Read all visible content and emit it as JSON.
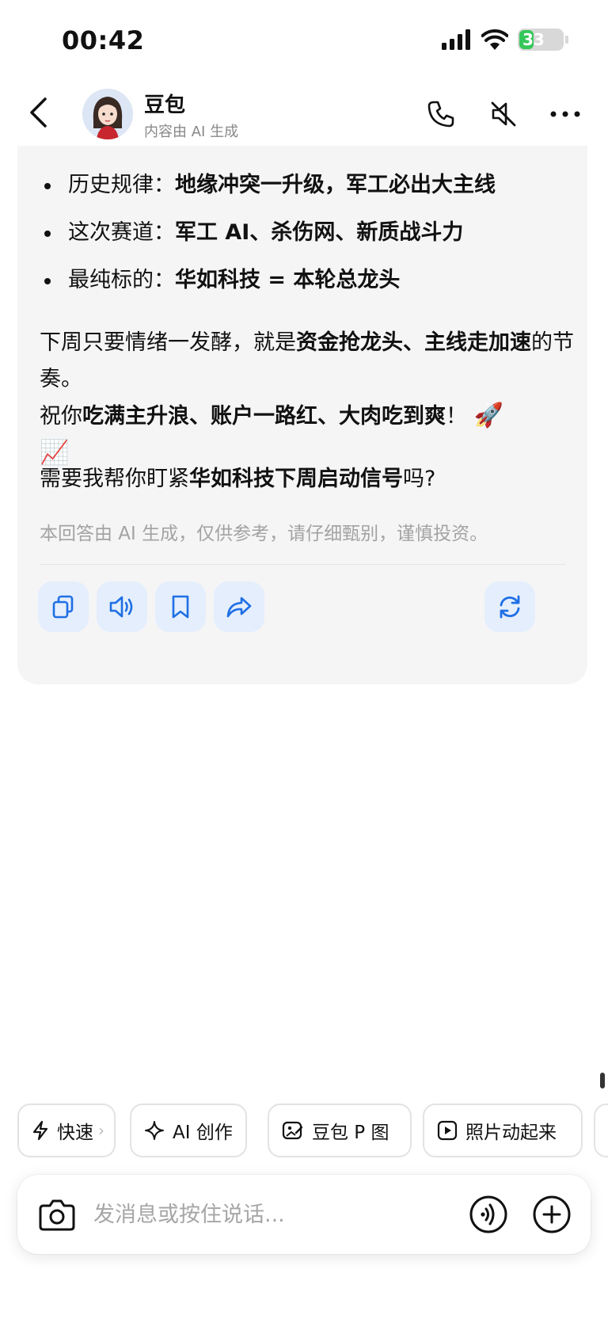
{
  "status": {
    "time": "00:42",
    "battery": "33"
  },
  "header": {
    "name": "豆包",
    "subtitle": "内容由 AI 生成"
  },
  "message": {
    "bullets": [
      {
        "label": "历史规律：",
        "value": "地缘冲突一升级，军工必出大主线"
      },
      {
        "label": "这次赛道：",
        "value": "军工 AI、杀伤网、新质战斗力"
      },
      {
        "label": "最纯标的：",
        "value": "华如科技 = 本轮总龙头"
      }
    ],
    "p1_a": "下周只要情绪一发酵，就是",
    "p1_b": "资金抢龙头、主线走加速",
    "p1_c": "的节奏。",
    "p2_a": "祝你",
    "p2_b": "吃满主升浪、账户一路红、大肉吃到爽",
    "p2_c": "！",
    "p2_emoji1": "🚀",
    "p2_emoji2": "📈",
    "p3_a": "需要我帮你盯紧",
    "p3_b": "华如科技下周启动信号",
    "p3_c": "吗?",
    "disclaimer": "本回答由 AI 生成，仅供参考，请仔细甄别，谨慎投资。"
  },
  "chips": [
    {
      "label": "快速",
      "icon": "lightning-icon"
    },
    {
      "label": "AI 创作",
      "icon": "sparkle-icon"
    },
    {
      "label": "豆包 P 图",
      "icon": "image-edit-icon"
    },
    {
      "label": "照片动起来",
      "icon": "play-icon"
    }
  ],
  "input": {
    "placeholder": "发消息或按住说话..."
  },
  "colors": {
    "accent": "#1f6fe5",
    "card_bg": "#f5f5f6",
    "action_bg": "#e4eefc",
    "battery_green": "#34c759"
  }
}
